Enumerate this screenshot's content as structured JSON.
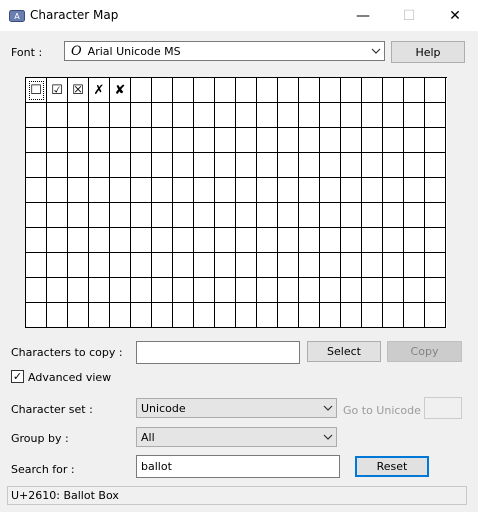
{
  "window": {
    "title": "Character Map",
    "minimize_glyph": "—",
    "maximize_glyph": "☐",
    "close_glyph": "✕"
  },
  "font_row": {
    "label": "Font :",
    "font_glyph": "O",
    "font_value": "Arial Unicode MS",
    "help_label": "Help"
  },
  "grid": {
    "chars": [
      "☐",
      "☑",
      "☒",
      "✗",
      "✘"
    ]
  },
  "copy_row": {
    "label": "Characters to copy :",
    "value": "",
    "select_label": "Select",
    "copy_label": "Copy"
  },
  "advanced": {
    "label": "Advanced view",
    "checked": true,
    "check_glyph": "✓"
  },
  "character_set": {
    "label": "Character set :",
    "value": "Unicode",
    "goto_label": "Go to Unicode :",
    "goto_value": ""
  },
  "group_by": {
    "label": "Group by :",
    "value": "All"
  },
  "search": {
    "label": "Search for :",
    "value": "ballot",
    "reset_label": "Reset"
  },
  "status": {
    "text": "U+2610: Ballot Box"
  }
}
